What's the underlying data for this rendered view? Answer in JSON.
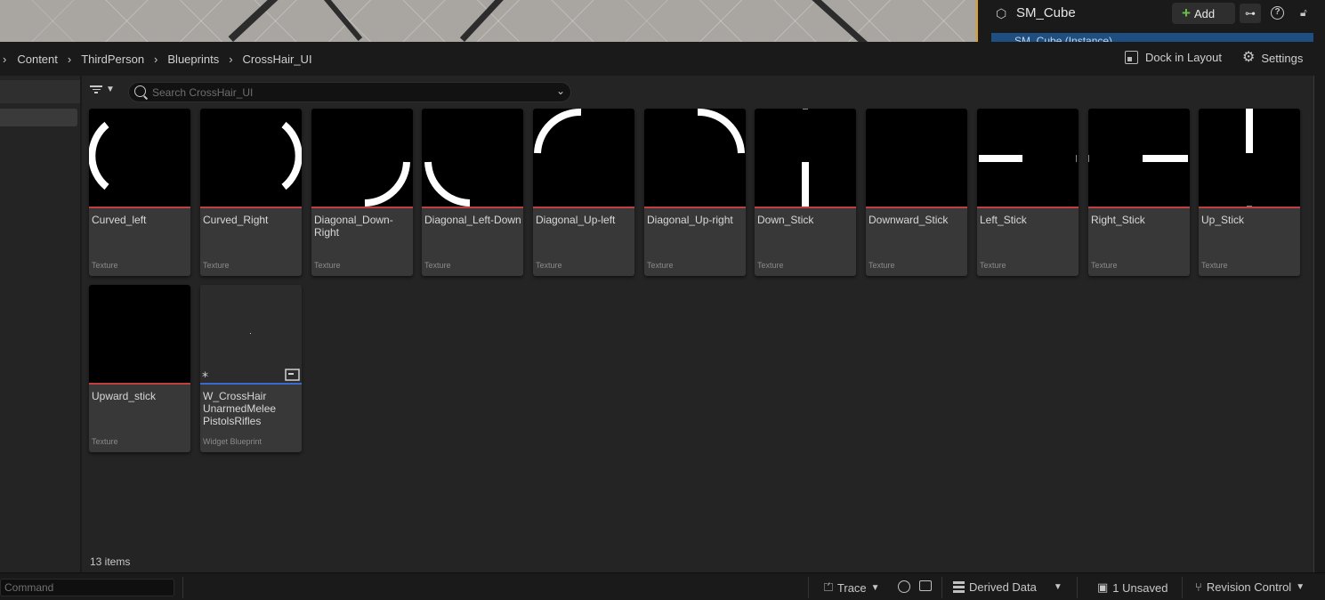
{
  "details": {
    "title": "SM_Cube",
    "add_label": "Add",
    "instance_label": "SM_Cube (Instance)"
  },
  "breadcrumb": [
    "Content",
    "ThirdPerson",
    "Blueprints",
    "CrossHair_UI"
  ],
  "toolbar": {
    "dock_label": "Dock in Layout",
    "settings_label": "Settings"
  },
  "search": {
    "placeholder": "Search CrossHair_UI"
  },
  "assets": [
    {
      "name": "Curved_left",
      "type": "Texture",
      "thumb": "curved-left"
    },
    {
      "name": "Curved_Right",
      "type": "Texture",
      "thumb": "curved-right"
    },
    {
      "name": "Diagonal_Down-Right",
      "type": "Texture",
      "thumb": "diag-down-right"
    },
    {
      "name": "Diagonal_Left-Down",
      "type": "Texture",
      "thumb": "diag-left-down"
    },
    {
      "name": "Diagonal_Up-left",
      "type": "Texture",
      "thumb": "diag-up-left"
    },
    {
      "name": "Diagonal_Up-right",
      "type": "Texture",
      "thumb": "diag-up-right"
    },
    {
      "name": "Down_Stick",
      "type": "Texture",
      "thumb": "down-stick"
    },
    {
      "name": "Downward_Stick",
      "type": "Texture",
      "thumb": "blank"
    },
    {
      "name": "Left_Stick",
      "type": "Texture",
      "thumb": "left-stick"
    },
    {
      "name": "Right_Stick",
      "type": "Texture",
      "thumb": "right-stick"
    },
    {
      "name": "Up_Stick",
      "type": "Texture",
      "thumb": "up-stick"
    },
    {
      "name": "Upward_stick",
      "type": "Texture",
      "thumb": "blank"
    },
    {
      "name": "W_CrossHair UnarmedMelee PistolsRifles",
      "type": "Widget Blueprint",
      "thumb": "widget"
    }
  ],
  "items_count": "13 items",
  "statusbar": {
    "command_placeholder": "Command",
    "trace_label": "Trace",
    "derived_data_label": "Derived Data",
    "unsaved_label": "1 Unsaved",
    "revision_label": "Revision Control"
  }
}
